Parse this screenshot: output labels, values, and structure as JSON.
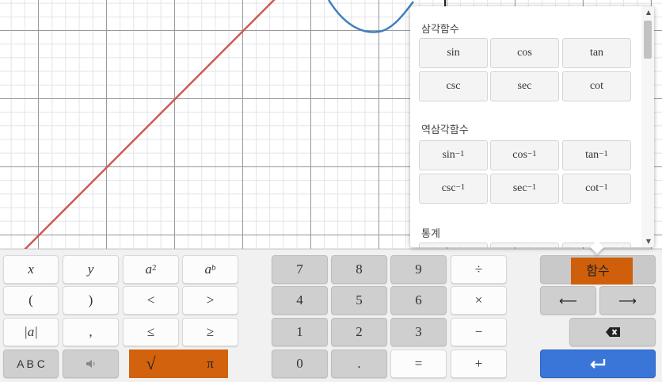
{
  "graph": {
    "line_color": "#cc5a55",
    "curve_color": "#3f7fc0"
  },
  "popup": {
    "sections": [
      {
        "title": "삼각함수",
        "buttons": [
          "sin",
          "cos",
          "tan",
          "csc",
          "sec",
          "cot"
        ]
      },
      {
        "title": "역삼각함수",
        "buttons": [
          {
            "base": "sin",
            "sup": "−1"
          },
          {
            "base": "cos",
            "sup": "−1"
          },
          {
            "base": "tan",
            "sup": "−1"
          },
          {
            "base": "csc",
            "sup": "−1"
          },
          {
            "base": "sec",
            "sup": "−1"
          },
          {
            "base": "cot",
            "sup": "−1"
          }
        ]
      },
      {
        "title": "통계"
      }
    ]
  },
  "keys": {
    "x": "x",
    "y": "y",
    "a2_base": "a",
    "a2_sup": "2",
    "ab_base": "a",
    "ab_sup": "b",
    "lparen": "(",
    "rparen": ")",
    "lt": "<",
    "gt": ">",
    "abs": "|a|",
    "comma": ",",
    "le": "≤",
    "ge": "≥",
    "abc": "A B C",
    "sqrt": "√",
    "pi": "π",
    "n7": "7",
    "n8": "8",
    "n9": "9",
    "div": "÷",
    "n4": "4",
    "n5": "5",
    "n6": "6",
    "times": "×",
    "n1": "1",
    "n2": "2",
    "n3": "3",
    "minus": "−",
    "n0": "0",
    "dot": ".",
    "eq": "=",
    "plus": "+",
    "func": "함수",
    "left": "⟵",
    "right": "⟶"
  },
  "colors": {
    "highlight": "#d05a00",
    "enter": "#3a76d8"
  }
}
